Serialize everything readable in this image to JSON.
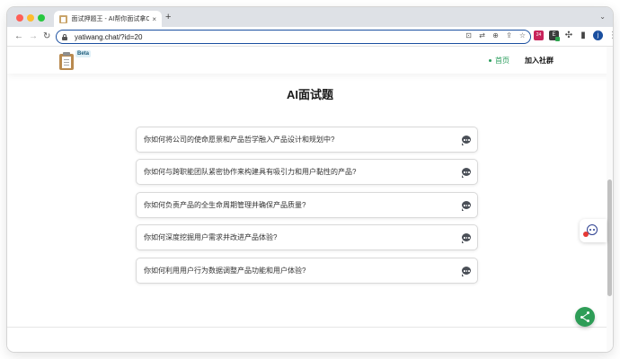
{
  "browser": {
    "tab_title": "面试押题王 - AI帮你面试拿Offer",
    "tab_close": "×",
    "new_tab": "+",
    "url": "yatiwang.chat/?id=20",
    "extension_badge": "24",
    "extension_letter": "E",
    "profile_letter": "j"
  },
  "site": {
    "beta_label": "Beta",
    "nav": {
      "home": "首页",
      "community": "加入社群"
    },
    "page_title": "AI面试题",
    "questions": [
      "你如何将公司的使命愿景和产品哲学融入产品设计和规划中?",
      "你如何与跨职能团队紧密协作来构建具有吸引力和用户黏性的产品?",
      "你如何负责产品的全生命周期管理并确保产品质量?",
      "你如何深度挖掘用户需求并改进产品体验?",
      "你如何利用用户行为数据调整产品功能和用户体验?"
    ]
  },
  "colors": {
    "accent_green": "#2e9d57",
    "omnibox_border": "#1a4fa0"
  }
}
